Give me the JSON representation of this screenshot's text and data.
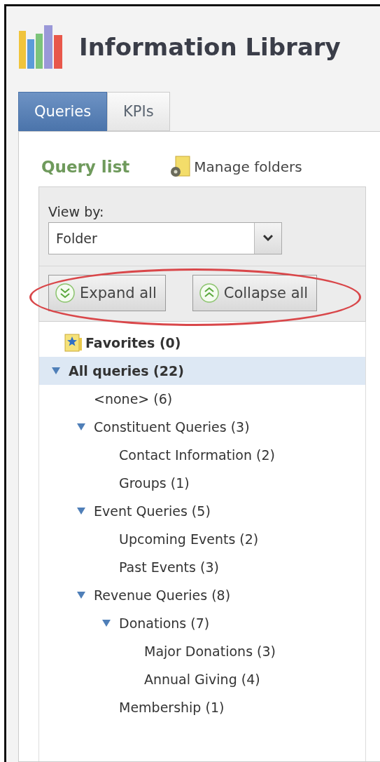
{
  "header": {
    "title": "Information Library"
  },
  "tabs": [
    {
      "label": "Queries",
      "selected": true
    },
    {
      "label": "KPIs",
      "selected": false
    }
  ],
  "query_list": {
    "heading": "Query list",
    "manage_link": "Manage folders"
  },
  "filter": {
    "label": "View by:",
    "value": "Folder"
  },
  "buttons": [
    {
      "kind": "expand",
      "label": "Expand all"
    },
    {
      "kind": "collapse",
      "label": "Collapse all"
    }
  ],
  "tree": [
    {
      "kind": "favorites",
      "label": "Favorites (0)",
      "selected": false
    },
    {
      "kind": "folder",
      "label": "All queries (22)",
      "selected": true,
      "expanded": true,
      "children": [
        {
          "kind": "folder",
          "label": "<none> (6)",
          "selected": false
        },
        {
          "kind": "folder",
          "label": "Constituent Queries (3)",
          "selected": false,
          "expanded": true,
          "children": [
            {
              "kind": "folder",
              "label": "Contact Information (2)",
              "selected": false
            },
            {
              "kind": "folder",
              "label": "Groups (1)",
              "selected": false
            }
          ]
        },
        {
          "kind": "folder",
          "label": "Event Queries (5)",
          "selected": false,
          "expanded": true,
          "children": [
            {
              "kind": "folder",
              "label": "Upcoming Events (2)",
              "selected": false
            },
            {
              "kind": "folder",
              "label": "Past Events (3)",
              "selected": false
            }
          ]
        },
        {
          "kind": "folder",
          "label": "Revenue Queries (8)",
          "selected": false,
          "expanded": true,
          "children": [
            {
              "kind": "folder",
              "label": "Donations (7)",
              "selected": false,
              "expanded": true,
              "children": [
                {
                  "kind": "folder",
                  "label": "Major Donations (3)",
                  "selected": false
                },
                {
                  "kind": "folder",
                  "label": "Annual Giving (4)",
                  "selected": false
                }
              ]
            },
            {
              "kind": "folder",
              "label": "Membership (1)",
              "selected": false
            }
          ]
        }
      ]
    }
  ]
}
